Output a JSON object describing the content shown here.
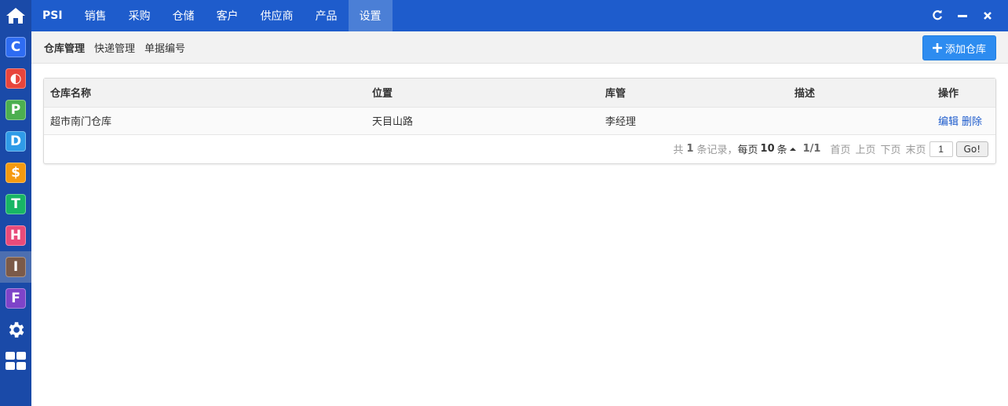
{
  "topnav": {
    "brand": "PSI",
    "items": [
      "销售",
      "采购",
      "仓储",
      "客户",
      "供应商",
      "产品",
      "设置"
    ]
  },
  "sidebar": {
    "home_icon": "home-icon",
    "apps": [
      {
        "letter": "C",
        "icon": "app-c-icon",
        "color": "#2e6cf2"
      },
      {
        "letter": "◐",
        "icon": "app-o-icon",
        "color": "#e8453c"
      },
      {
        "letter": "P",
        "icon": "app-p-icon",
        "color": "#4caf50"
      },
      {
        "letter": "D",
        "icon": "app-d-icon",
        "color": "#2f9be8"
      },
      {
        "letter": "$",
        "icon": "app-s-icon",
        "color": "#f59a10"
      },
      {
        "letter": "T",
        "icon": "app-t-icon",
        "color": "#18b565"
      },
      {
        "letter": "H",
        "icon": "app-h-icon",
        "color": "#e94b7a"
      },
      {
        "letter": "I",
        "icon": "app-i-icon",
        "color": "#7b5a48"
      },
      {
        "letter": "F",
        "icon": "app-f-icon",
        "color": "#7e44c9"
      }
    ],
    "settings_icon": "gear-icon",
    "grid_icon": "grid-icon"
  },
  "subnav": {
    "items": [
      "仓库管理",
      "快递管理",
      "单据编号"
    ]
  },
  "actions": {
    "add_label": "添加仓库"
  },
  "table": {
    "headers": [
      "仓库名称",
      "位置",
      "库管",
      "描述",
      "操作"
    ],
    "rows": [
      {
        "name": "超市南门仓库",
        "location": "天目山路",
        "manager": "李经理",
        "desc": "",
        "ops": [
          "编辑",
          "删除"
        ]
      }
    ]
  },
  "pager": {
    "total_prefix": "共",
    "total": "1",
    "total_suffix": "条记录，",
    "per_page_prefix": "每页",
    "per_page": "10",
    "per_page_suffix": "条",
    "page_info": "1/1",
    "first": "首页",
    "prev": "上页",
    "next": "下页",
    "last": "末页",
    "page_input": "1",
    "go": "Go!"
  },
  "colors": {
    "topbar": "#1e5ccc",
    "sidebar": "#1a4aa8",
    "accent": "#2d8cf0"
  }
}
